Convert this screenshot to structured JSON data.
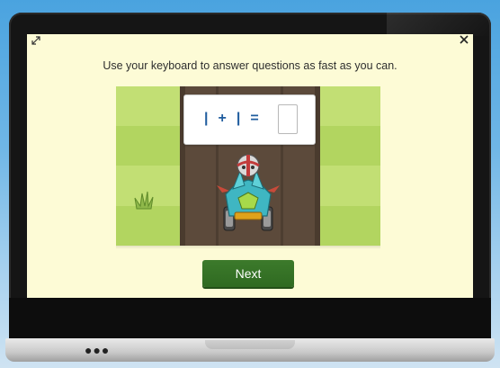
{
  "prompt": {
    "instruction": "Use your keyboard to answer questions as fast as you can."
  },
  "question": {
    "operand_a": "|",
    "operator": "+",
    "operand_b": "|",
    "equals": "=",
    "answer_value": ""
  },
  "controls": {
    "next_label": "Next",
    "expand_icon": "expand-icon",
    "close_icon": "close-icon"
  },
  "device": {
    "dots_label": "●●●"
  },
  "colors": {
    "screen_bg": "#fdfbd6",
    "grass_light": "#c2df74",
    "grass_dark": "#a9cf58",
    "road": "#5c4a3b",
    "equation_text": "#1f5c9e",
    "next_button": "#3a7a2b"
  }
}
